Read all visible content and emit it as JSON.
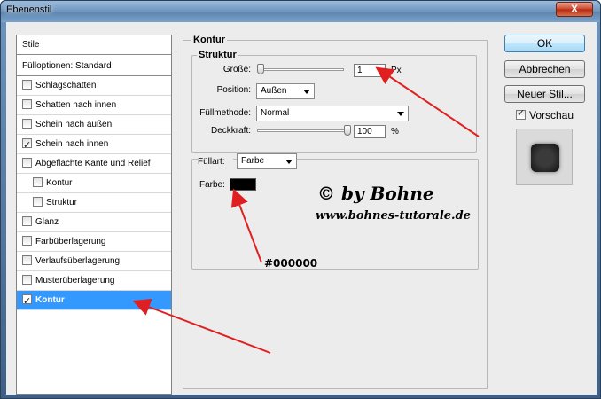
{
  "window": {
    "title": "Ebenenstil",
    "close_glyph": "X"
  },
  "sidebar": {
    "header": "Stile",
    "fill_options": "Fülloptionen: Standard",
    "items": [
      {
        "label": "Schlagschatten",
        "checked": false
      },
      {
        "label": "Schatten nach innen",
        "checked": false
      },
      {
        "label": "Schein nach außen",
        "checked": false
      },
      {
        "label": "Schein nach innen",
        "checked": true
      },
      {
        "label": "Abgeflachte Kante und Relief",
        "checked": false
      },
      {
        "label": "Kontur",
        "checked": false,
        "indent": true
      },
      {
        "label": "Struktur",
        "checked": false,
        "indent": true
      },
      {
        "label": "Glanz",
        "checked": false
      },
      {
        "label": "Farbüberlagerung",
        "checked": false
      },
      {
        "label": "Verlaufsüberlagerung",
        "checked": false
      },
      {
        "label": "Musterüberlagerung",
        "checked": false
      },
      {
        "label": "Kontur",
        "checked": true,
        "selected": true
      }
    ]
  },
  "panel": {
    "title": "Kontur",
    "structure_title": "Struktur",
    "size_label": "Größe:",
    "size_value": "1",
    "size_unit": "Px",
    "size_slider_level": 0.0,
    "position_label": "Position:",
    "position_value": "Außen",
    "blend_label": "Füllmethode:",
    "blend_value": "Normal",
    "opacity_label": "Deckkraft:",
    "opacity_value": "100",
    "opacity_unit": "%",
    "opacity_slider_level": 1.0,
    "fill_type_label": "Füllart:",
    "fill_type_value": "Farbe",
    "color_label": "Farbe:",
    "color_value": "#000000"
  },
  "buttons": {
    "ok": "OK",
    "cancel": "Abbrechen",
    "new_style": "Neuer Stil...",
    "preview_label": "Vorschau",
    "preview_checked": true
  },
  "annotations": {
    "copyright": "© by Bohne",
    "website": "www.bohnes-tutorale.de",
    "hex_label": "#000000",
    "arrow_color": "#e02020"
  },
  "colors": {
    "accent_selection": "#3399ff",
    "swatch": "#000000"
  }
}
